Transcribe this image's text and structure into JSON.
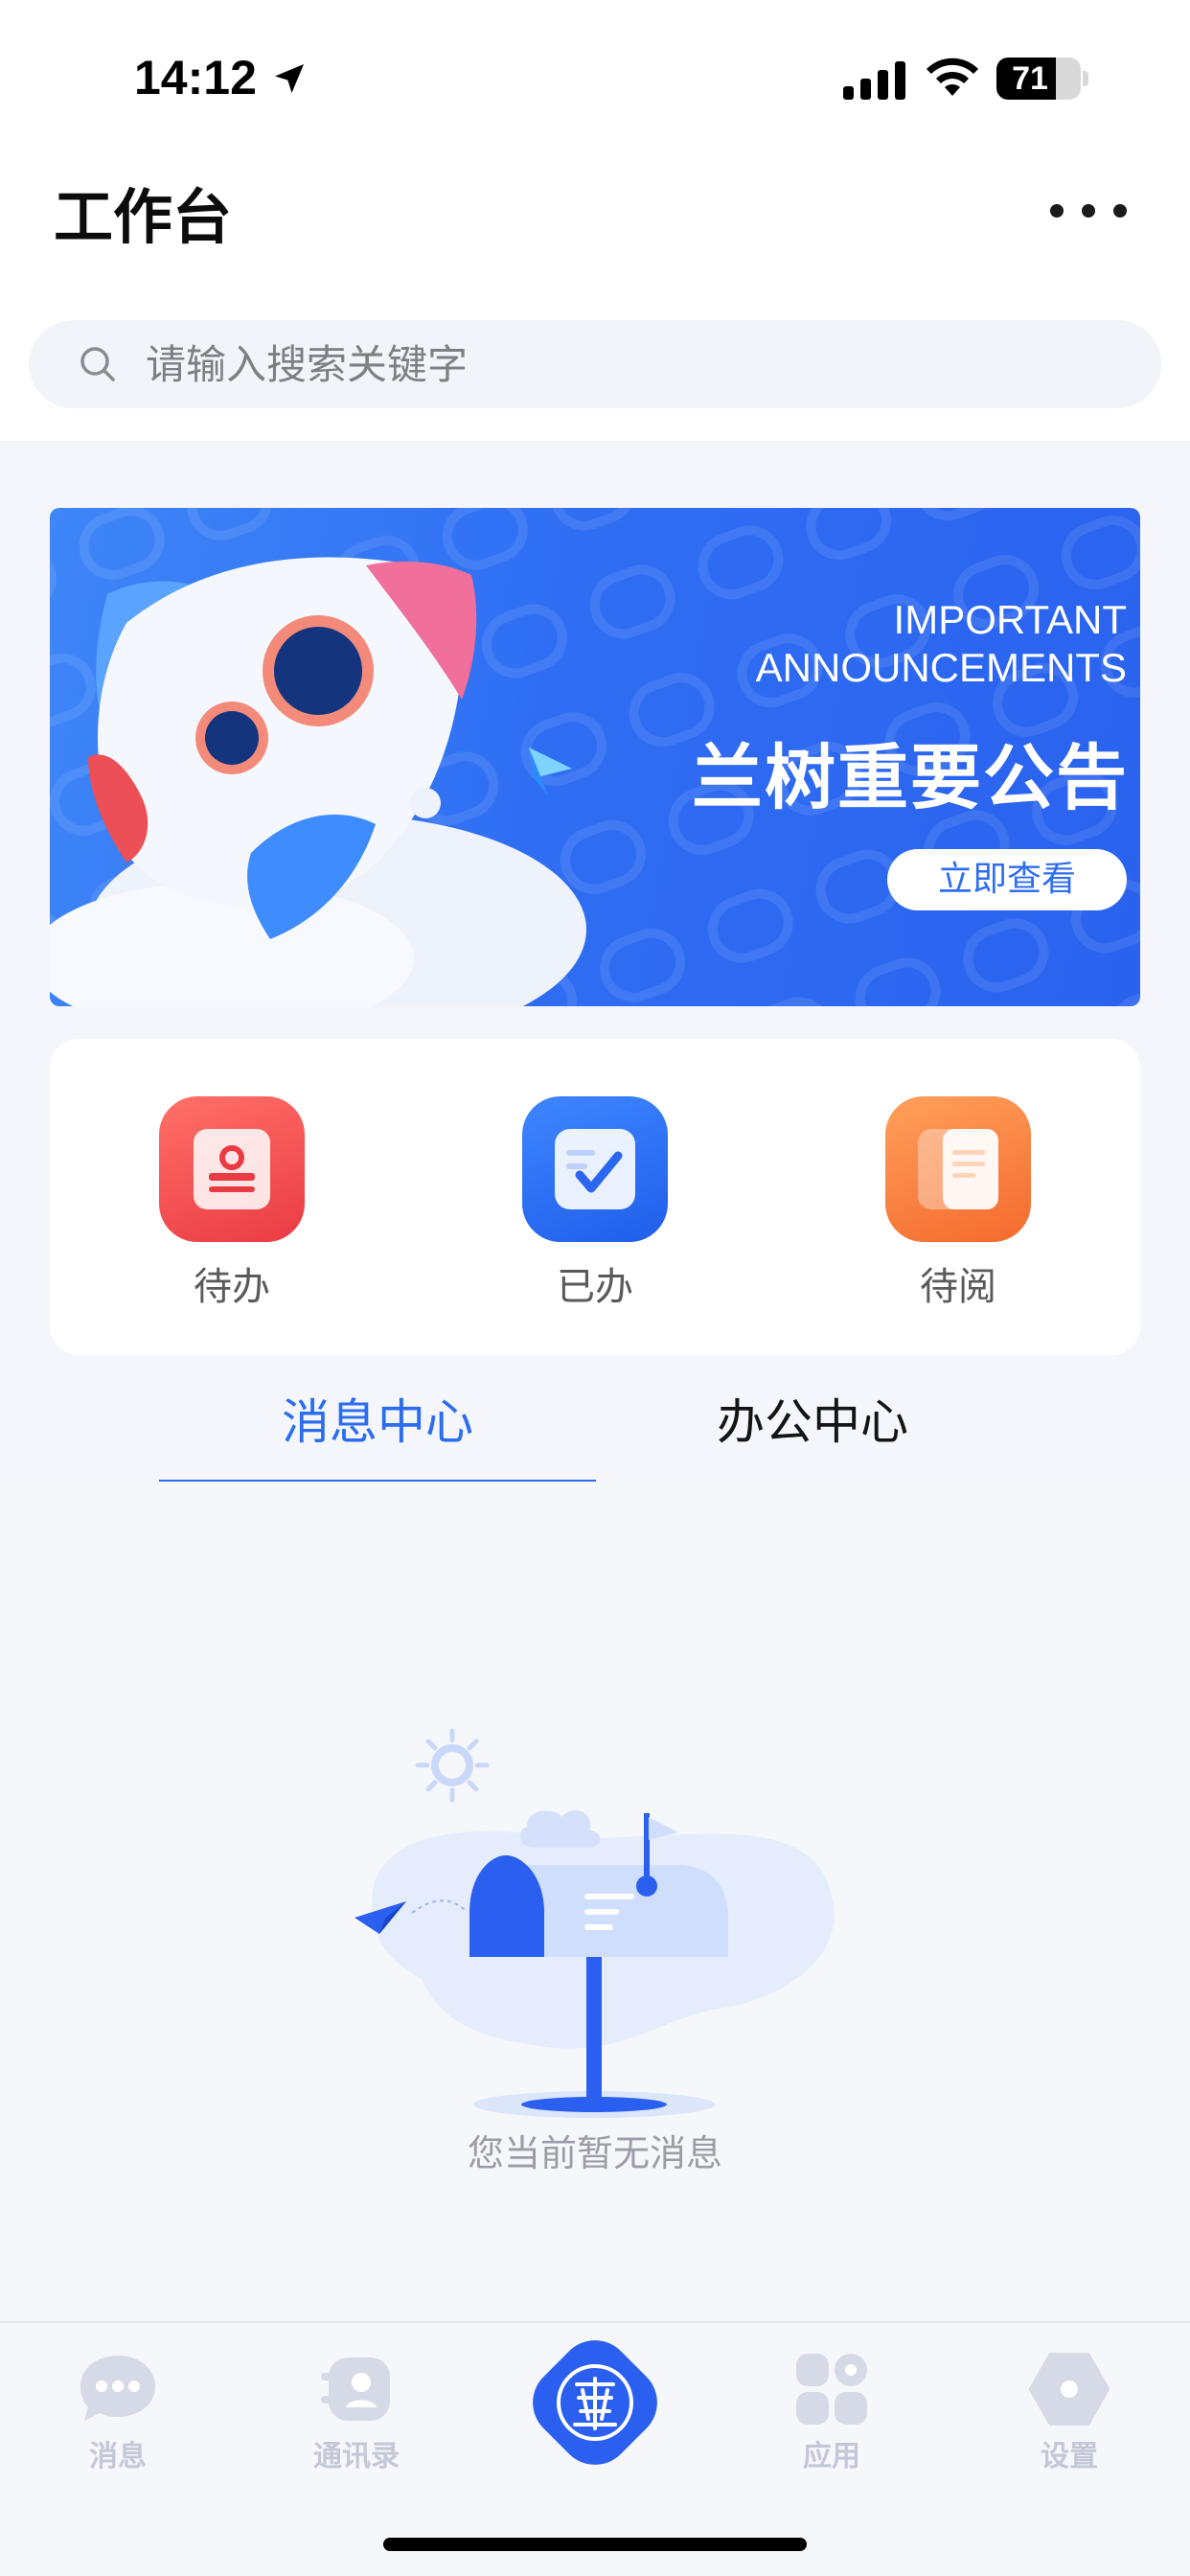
{
  "status_bar": {
    "time": "14:12",
    "battery_level": "71",
    "battery_fraction": 0.71,
    "icons": [
      "location-arrow-icon",
      "cellular-signal-icon",
      "wifi-icon",
      "battery-icon"
    ]
  },
  "header": {
    "title": "工作台",
    "more_icon": "ellipsis-icon"
  },
  "search": {
    "placeholder": "请输入搜索关键字",
    "icon": "search-icon"
  },
  "banner": {
    "title_en_line1": "IMPORTANT",
    "title_en_line2": "ANNOUNCEMENTS",
    "title_cn": "兰树重要公告",
    "button_label": "立即查看",
    "colors": {
      "background": "#2f6ef3",
      "button_text": "#2f6ef3"
    }
  },
  "quick_actions": [
    {
      "label": "待办",
      "icon": "stamp-icon",
      "color": "#ea3b44"
    },
    {
      "label": "已办",
      "icon": "checkbox-icon",
      "color": "#1f5eea"
    },
    {
      "label": "待阅",
      "icon": "document-icon",
      "color": "#f46a2e"
    }
  ],
  "tabs": {
    "items": [
      {
        "label": "消息中心",
        "active": true
      },
      {
        "label": "办公中心",
        "active": false
      }
    ],
    "active_color": "#2b6cf0"
  },
  "empty_state": {
    "message": "您当前暂无消息",
    "icon": "mailbox-illustration"
  },
  "bottom_nav": {
    "items": [
      {
        "label": "消息",
        "icon": "chat-bubble-icon"
      },
      {
        "label": "通讯录",
        "icon": "contacts-icon"
      },
      {
        "label": "",
        "icon": "home-logo-icon"
      },
      {
        "label": "应用",
        "icon": "apps-grid-icon"
      },
      {
        "label": "设置",
        "icon": "settings-hexagon-icon"
      }
    ],
    "inactive_color": "#c4c8d6",
    "home_color": "#2b5ff0"
  }
}
